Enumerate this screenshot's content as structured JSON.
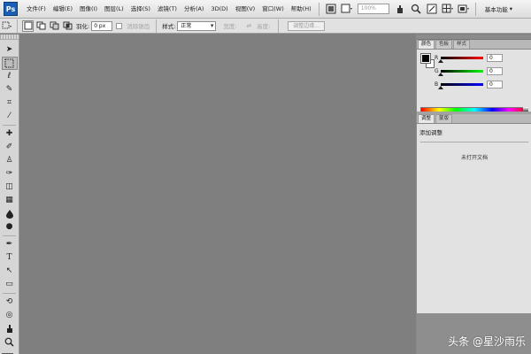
{
  "app": {
    "logo_text": "Ps"
  },
  "menubar": {
    "items": [
      "文件(F)",
      "编辑(E)",
      "图像(I)",
      "图层(L)",
      "选择(S)",
      "滤镜(T)",
      "分析(A)",
      "3D(D)",
      "视图(V)",
      "窗口(W)",
      "帮助(H)"
    ],
    "zoom_value": "100%",
    "workspace_label": "基本功能"
  },
  "optionsbar": {
    "feather_label": "羽化:",
    "feather_value": "0 px",
    "antialias_label": "消除锯齿",
    "style_label": "样式:",
    "style_value": "正常",
    "width_label": "宽度:",
    "height_label": "高度:",
    "refine_edge_label": "调整边缘..."
  },
  "toolbox": {
    "tools": [
      {
        "name": "move-tool",
        "glyph": "➤"
      },
      {
        "name": "marquee-tool",
        "glyph": "⬚"
      },
      {
        "name": "lasso-tool",
        "glyph": "ℓ"
      },
      {
        "name": "quick-select-tool",
        "glyph": "✎"
      },
      {
        "name": "crop-tool",
        "glyph": "⌗"
      },
      {
        "name": "eyedropper-tool",
        "glyph": "⁄"
      },
      {
        "name": "healing-brush-tool",
        "glyph": "✚"
      },
      {
        "name": "brush-tool",
        "glyph": "✐"
      },
      {
        "name": "clone-stamp-tool",
        "glyph": "♙"
      },
      {
        "name": "history-brush-tool",
        "glyph": "✑"
      },
      {
        "name": "eraser-tool",
        "glyph": "◫"
      },
      {
        "name": "gradient-tool",
        "glyph": "▦"
      },
      {
        "name": "blur-tool",
        "glyph": "💧"
      },
      {
        "name": "dodge-tool",
        "glyph": "●"
      },
      {
        "name": "pen-tool",
        "glyph": "✒"
      },
      {
        "name": "type-tool",
        "glyph": "T"
      },
      {
        "name": "path-select-tool",
        "glyph": "↖"
      },
      {
        "name": "shape-tool",
        "glyph": "▭"
      },
      {
        "name": "3d-rotate-tool",
        "glyph": "⟲"
      },
      {
        "name": "3d-orbit-tool",
        "glyph": "◎"
      },
      {
        "name": "hand-tool",
        "glyph": "✋"
      },
      {
        "name": "zoom-tool",
        "glyph": "🔍"
      }
    ],
    "colors": {
      "foreground": "#000000",
      "background": "#ffffff"
    }
  },
  "color_panel": {
    "tabs": [
      "颜色",
      "色板",
      "样式"
    ],
    "sliders": [
      {
        "label": "R",
        "value": "0",
        "gradient": "#ff0000"
      },
      {
        "label": "G",
        "value": "0",
        "gradient": "#00ff00"
      },
      {
        "label": "B",
        "value": "0",
        "gradient": "#0000ff"
      }
    ]
  },
  "history_panel": {
    "tabs": [
      "调整",
      "蒙版"
    ],
    "title": "添加调整",
    "message": "未打开文档"
  },
  "watermark": "头条 @星沙雨乐"
}
